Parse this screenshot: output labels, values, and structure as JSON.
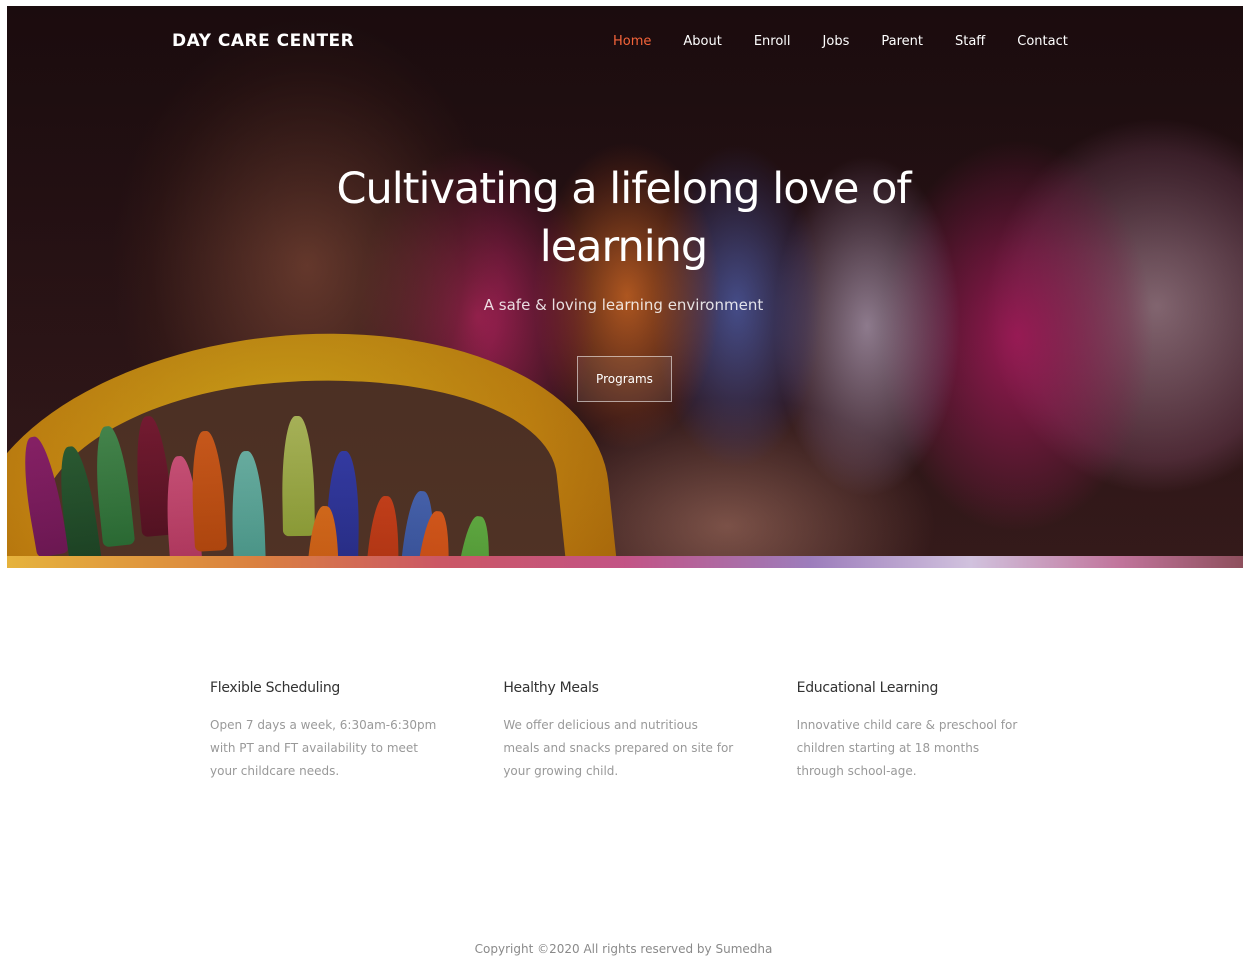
{
  "header": {
    "brand": "DAY CARE CENTER",
    "nav": [
      {
        "label": "Home",
        "active": true
      },
      {
        "label": "About"
      },
      {
        "label": "Enroll"
      },
      {
        "label": "Jobs"
      },
      {
        "label": "Parent"
      },
      {
        "label": "Staff"
      },
      {
        "label": "Contact"
      }
    ],
    "accent_color": "#f5643a"
  },
  "hero": {
    "title_line1": "Cultivating a lifelong love of",
    "title_line2": "learning",
    "subtitle": "A safe & loving learning environment",
    "cta_label": "Programs"
  },
  "features": [
    {
      "title": "Flexible Scheduling",
      "text": "Open 7 days a week, 6:30am-6:30pm with PT and FT availability to meet your childcare needs."
    },
    {
      "title": "Healthy Meals",
      "text": "We offer delicious and nutritious meals and snacks prepared on site for your growing child."
    },
    {
      "title": "Educational Learning",
      "text": "Innovative child care & preschool for children starting at 18 months through school-age."
    }
  ],
  "footer": {
    "copyright": "Copyright ©2020 All rights reserved by Sumedha"
  }
}
